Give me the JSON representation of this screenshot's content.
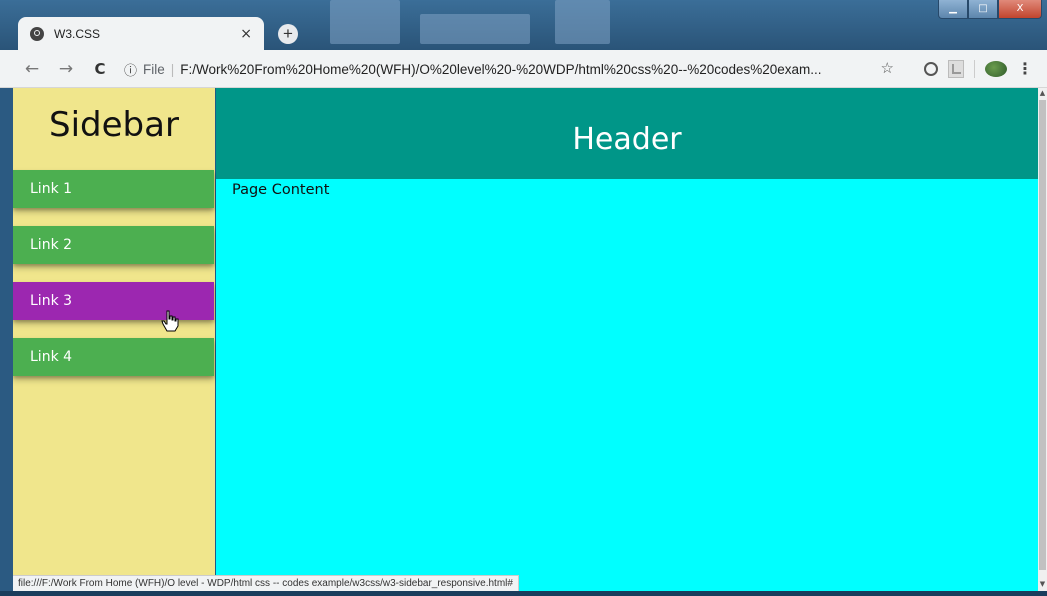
{
  "browser": {
    "tab": {
      "title": "W3.CSS",
      "close_glyph": "×",
      "icon": "globe-icon"
    },
    "new_tab_glyph": "+",
    "window_controls": {
      "minimize": "▁",
      "maximize": "□",
      "close": "X"
    },
    "nav": {
      "back": "←",
      "forward": "→",
      "reload": "C"
    },
    "omnibox": {
      "info_glyph": "ⓘ",
      "scheme_chip": "File",
      "separator": "|",
      "url": "F:/Work%20From%20Home%20(WFH)/O%20level%20-%20WDP/html%20css%20--%20codes%20exam...",
      "star_glyph": "☆"
    },
    "menu_glyph": "⋮",
    "status_url": "file:///F:/Work From Home (WFH)/O level - WDP/html css -- codes example/w3css/w3-sidebar_responsive.html#"
  },
  "page": {
    "sidebar": {
      "title": "Sidebar",
      "links": [
        {
          "label": "Link 1",
          "state": "normal"
        },
        {
          "label": "Link 2",
          "state": "normal"
        },
        {
          "label": "Link 3",
          "state": "hover"
        },
        {
          "label": "Link 4",
          "state": "normal"
        }
      ],
      "background": "#f0e68c",
      "link_color": "#4caf50",
      "hover_color": "#9c27b0"
    },
    "header": {
      "title": "Header",
      "background": "#009688"
    },
    "content": {
      "text": "Page Content",
      "background": "#00ffff"
    }
  }
}
